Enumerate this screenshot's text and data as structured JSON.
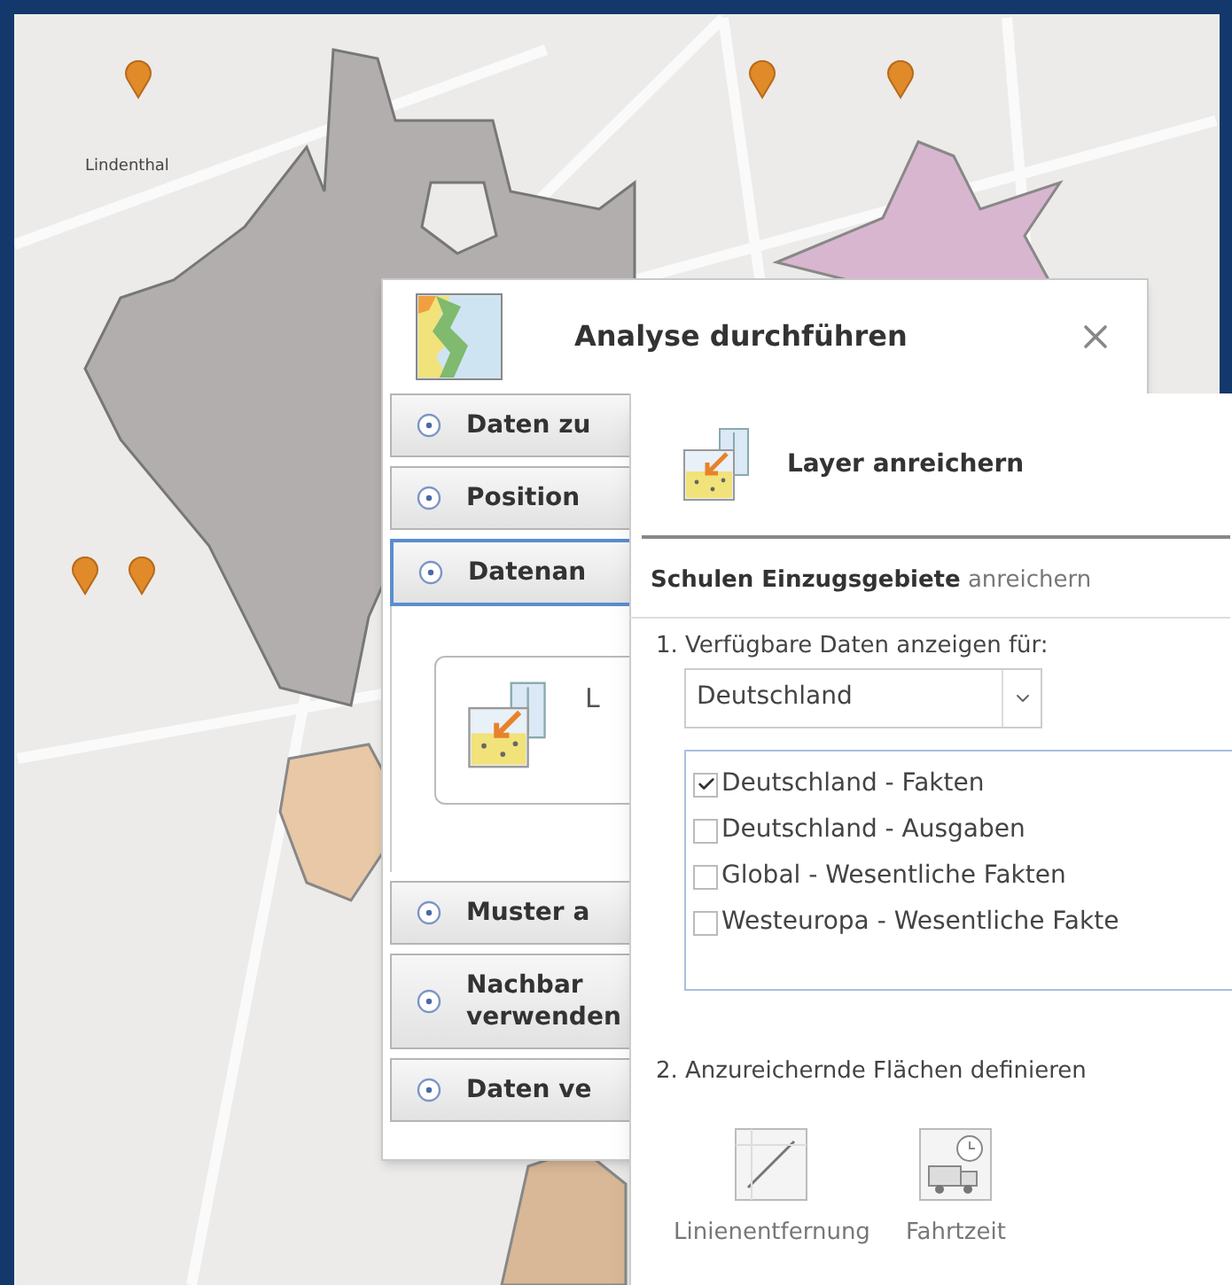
{
  "map": {
    "place_label": "Lindenthal"
  },
  "analysis_panel": {
    "title": "Analyse durchführen",
    "sections": [
      {
        "label": "Daten zu",
        "expanded": false
      },
      {
        "label": "Position",
        "expanded": false
      },
      {
        "label": "Datenan",
        "expanded": true,
        "card_label": "L"
      },
      {
        "label": "Muster a",
        "expanded": false
      },
      {
        "label": "Nachbar\nverwenden",
        "expanded": false
      },
      {
        "label": "Daten ve",
        "expanded": false
      }
    ]
  },
  "enrich_panel": {
    "title": "Layer anreichern",
    "subtitle": "**Schulen Einzugsgebiete** anreichern",
    "step1": "1. Verfügbare Daten anzeigen für:",
    "country": "Deutschland",
    "datasets": [
      {
        "label": "Deutschland - Fakten",
        "checked": true
      },
      {
        "label": "Deutschland - Ausgaben",
        "checked": false
      },
      {
        "label": "Global - Wesentliche Fakten",
        "checked": false
      },
      {
        "label": "Westeuropa - Wesentliche Fakte",
        "checked": false
      }
    ],
    "step2": "2. Anzureichernde Flächen definieren",
    "area_options": [
      {
        "kind": "line",
        "label": "Linienentfernung"
      },
      {
        "kind": "drive",
        "label": "Fahrtzeit"
      }
    ]
  }
}
